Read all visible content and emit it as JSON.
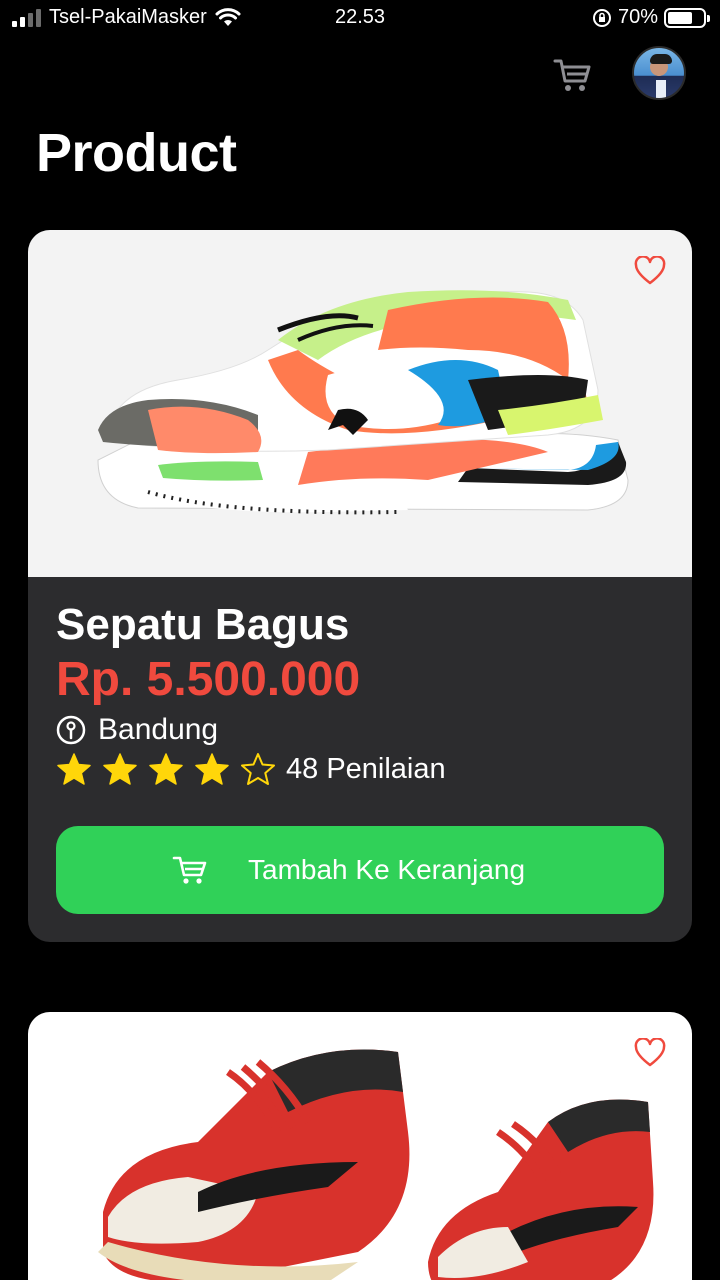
{
  "status_bar": {
    "carrier": "Tsel-PakaiMasker",
    "time": "22.53",
    "battery": "70%",
    "battery_level": 0.7
  },
  "header": {
    "title": "Product",
    "cart_icon": "cart-icon",
    "avatar": "profile-avatar"
  },
  "products": [
    {
      "name": "Sepatu Bagus",
      "price": "Rp. 5.500.000",
      "location": "Bandung",
      "rating": 4,
      "rating_max": 5,
      "reviews": "48 Penilaian",
      "button_label": "Tambah Ke Keranjang",
      "favorite_icon": "heart-outline-icon"
    },
    {
      "favorite_icon": "heart-outline-icon"
    }
  ],
  "colors": {
    "accent_green": "#30d158",
    "price_red": "#f04a3e",
    "card_bg": "#2c2c2e",
    "star_yellow": "#ffd60a"
  }
}
